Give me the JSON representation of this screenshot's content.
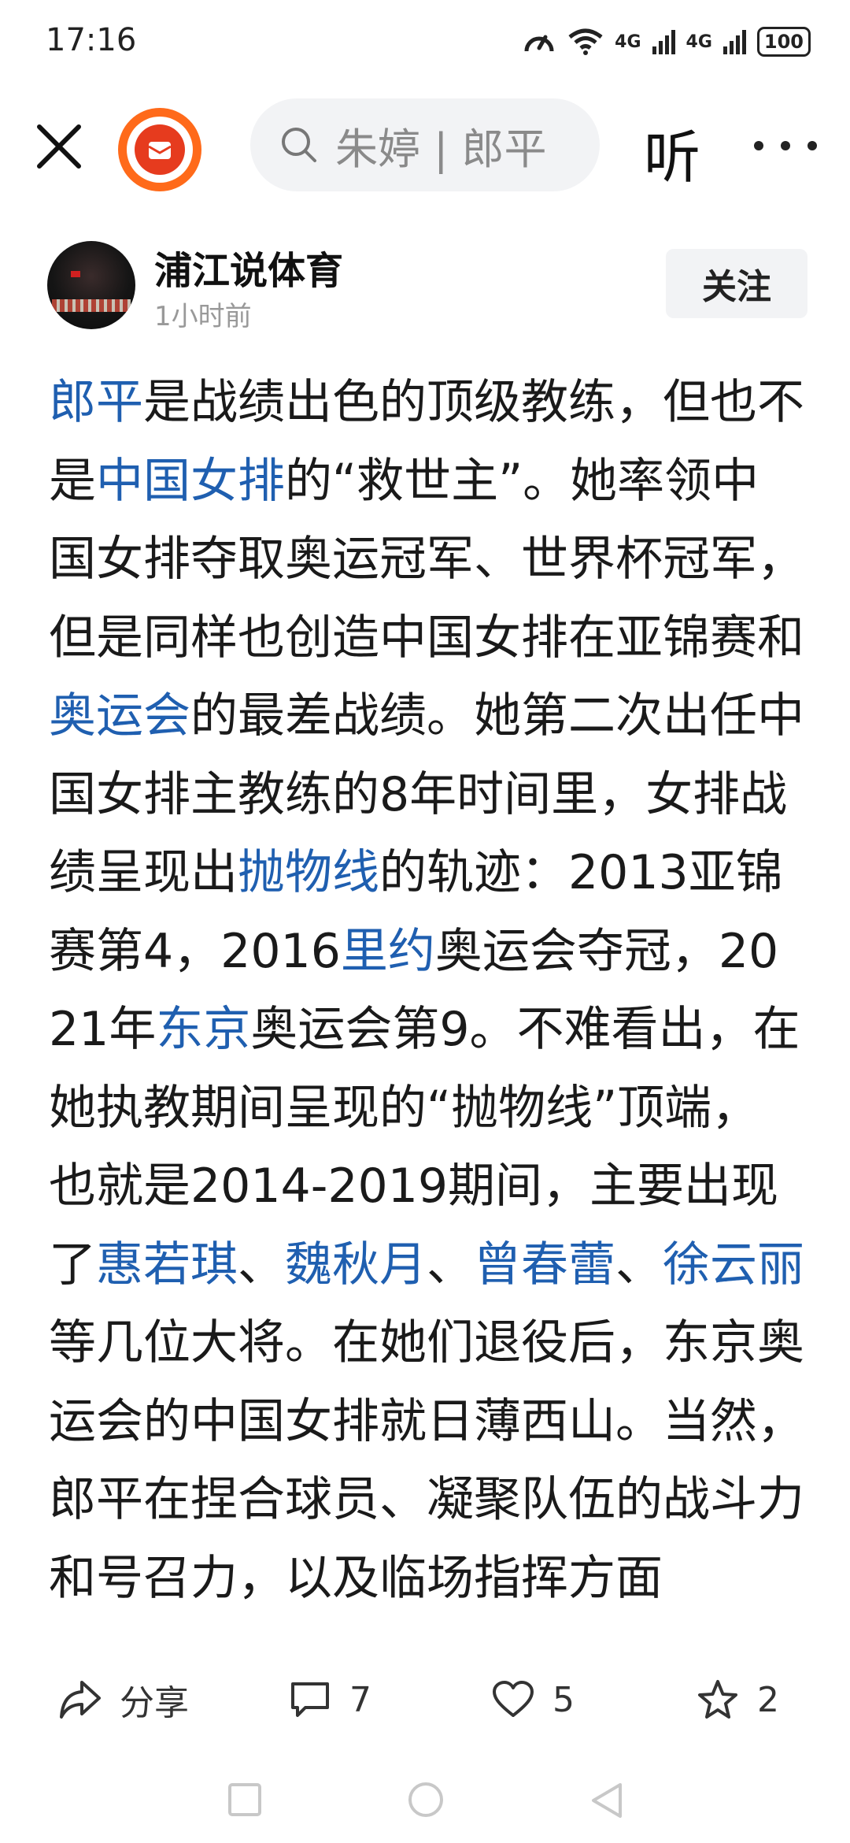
{
  "status_bar": {
    "time": "17:16",
    "net1": "4G",
    "net2": "4G",
    "battery": "100"
  },
  "top_bar": {
    "search_placeholder": "朱婷 | 郎平",
    "listen_label": "听"
  },
  "author": {
    "name": "浦江说体育",
    "time": "1小时前",
    "follow_label": "关注"
  },
  "article": {
    "segments": [
      {
        "text": "郎平",
        "link": true
      },
      {
        "text": "是战绩出色的顶级教练，但也不是",
        "link": false
      },
      {
        "text": "中国女排",
        "link": true
      },
      {
        "text": "的“救世主”。她率领中国女排夺取奥运冠军、世界杯冠军，但是同样也创造中国女排在亚锦赛和",
        "link": false
      },
      {
        "text": "奥运会",
        "link": true
      },
      {
        "text": "的最差战绩。她第二次出任中国女排主教练的8年时间里，女排战绩呈现出",
        "link": false
      },
      {
        "text": "抛物线",
        "link": true
      },
      {
        "text": "的轨迹：2013亚锦赛第4，2016",
        "link": false
      },
      {
        "text": "里约",
        "link": true
      },
      {
        "text": "奥运会夺冠，2021年",
        "link": false
      },
      {
        "text": "东京",
        "link": true
      },
      {
        "text": "奥运会第9。不难看出，在她执教期间呈现的“抛物线”顶端，也就是2014-2019期间，主要出现了",
        "link": false
      },
      {
        "text": "惠若琪",
        "link": true
      },
      {
        "text": "、",
        "link": false
      },
      {
        "text": "魏秋月",
        "link": true
      },
      {
        "text": "、",
        "link": false
      },
      {
        "text": "曾春蕾",
        "link": true
      },
      {
        "text": "、",
        "link": false
      },
      {
        "text": "徐云丽",
        "link": true
      },
      {
        "text": "等几位大将。在她们退役后，东京奥运会的中国女排就日薄西山。当然，郎平在捏合球员、凝聚队伍的战斗力和号召力，以及临场指挥方面",
        "link": false
      }
    ]
  },
  "actions": {
    "share_label": "分享",
    "comment_count": "7",
    "like_count": "5",
    "favorite_count": "2"
  },
  "colors": {
    "link": "#1f5fb0",
    "logo": "#ff6a1a",
    "logo_core": "#e63b1e"
  }
}
